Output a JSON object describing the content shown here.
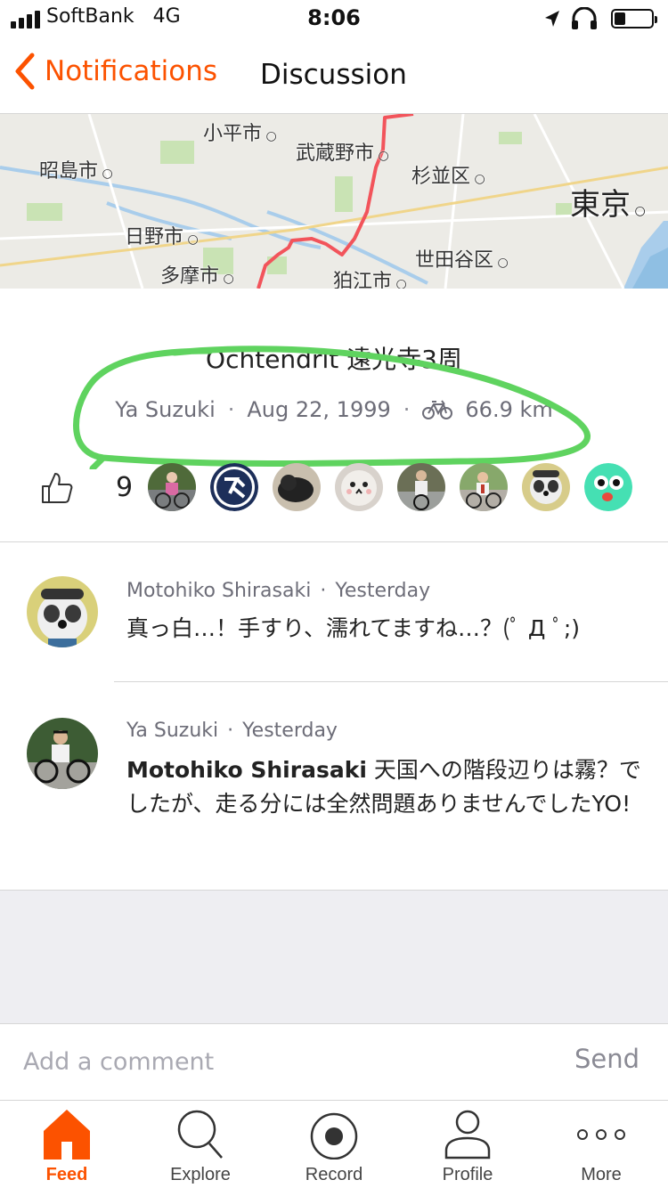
{
  "status_bar": {
    "carrier": "SoftBank",
    "network": "4G",
    "time": "8:06",
    "battery_level": 0.3
  },
  "nav": {
    "back_label": "Notifications",
    "title": "Discussion"
  },
  "map": {
    "labels": [
      "小平市",
      "武蔵野市",
      "昭島市",
      "杉並区",
      "東京",
      "日野市",
      "世田谷区",
      "多摩市",
      "狛江市"
    ]
  },
  "activity": {
    "title": "Ochtendrit 遠光寺3周",
    "athlete": "Ya Suzuki",
    "date": "Aug 22, 1999",
    "distance": "66.9 km",
    "kudos_count": "9"
  },
  "comments": [
    {
      "author": "Motohiko Shirasaki",
      "time": "Yesterday",
      "mention": "",
      "text": "真っ白…！手すり、濡れてますね…？(ﾟ Д ﾟ;)"
    },
    {
      "author": "Ya Suzuki",
      "time": "Yesterday",
      "mention": "Motohiko Shirasaki",
      "text": " 天国への階段辺りは霧？でしたが、走る分には全然問題ありませんでしたYO!"
    }
  ],
  "composer": {
    "placeholder": "Add a comment",
    "send_label": "Send"
  },
  "tabs": [
    {
      "label": "Feed",
      "icon": "home-icon",
      "active": true
    },
    {
      "label": "Explore",
      "icon": "search-icon",
      "active": false
    },
    {
      "label": "Record",
      "icon": "record-icon",
      "active": false
    },
    {
      "label": "Profile",
      "icon": "person-icon",
      "active": false
    },
    {
      "label": "More",
      "icon": "more-icon",
      "active": false
    }
  ],
  "colors": {
    "accent": "#fc5200",
    "highlight_marker": "#5fd35f",
    "route": "#f2545b"
  }
}
